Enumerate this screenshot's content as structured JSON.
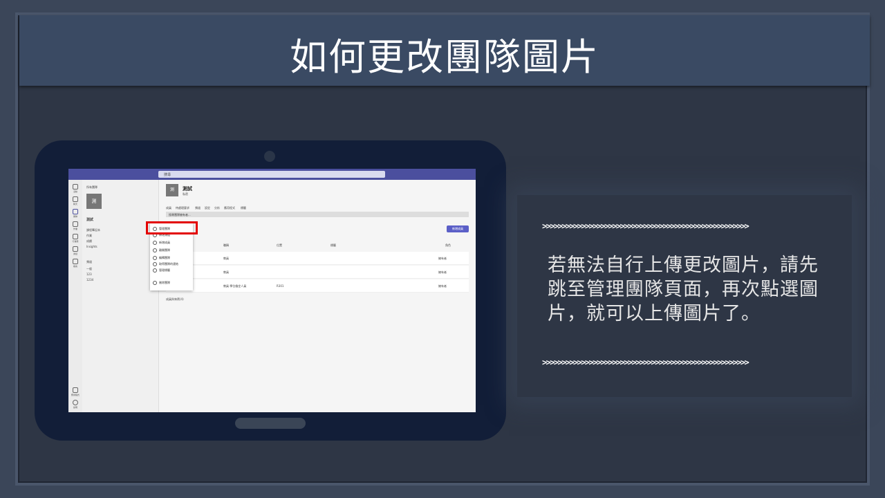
{
  "slide": {
    "title": "如何更改團隊圖片",
    "description": "若無法自行上傳更改圖片，請先跳至管理團隊頁面，再次點選圖片，就可以上傳圖片了。",
    "arrows_top": ">>>>>>>>>>>>>>>>>>>>>>>>>>>>>>>>>>>>>>>>>>>>>>>>>>>>>",
    "arrows_bottom": ">>>>>>>>>>>>>>>>>>>>>>>>>>>>>>>>>>>>>>>>>>>>>>>>>>>>>"
  },
  "screenshot": {
    "search_placeholder": "搜尋",
    "back_label": "所有團隊",
    "team_avatar_char": "測",
    "team_name": "測試",
    "team_subtitle": "私密",
    "left_items": [
      "課程筆記本",
      "作業",
      "成績",
      "Insights"
    ],
    "channels_header": "頻道",
    "channels": [
      "一般",
      "123",
      "1234"
    ],
    "tabs": [
      "成員",
      "待處理要求",
      "頻道",
      "設定",
      "分析",
      "應用程式",
      "標籤"
    ],
    "banner": "搜尋團隊擁有者...",
    "add_member": "新增成員",
    "columns": [
      "名稱",
      "職稱",
      "位置",
      "標籤",
      "角色"
    ],
    "rows": [
      {
        "title": "教員",
        "location": "",
        "role": "擁有者"
      },
      {
        "title": "教員",
        "location": "",
        "role": "擁有者"
      },
      {
        "title": "教員 學位檢定人員",
        "location": "R301",
        "role": "擁有者"
      }
    ],
    "members_footer": "成員與來賓(4)",
    "menu_items": [
      "管理團隊",
      "新增頻道",
      "新增成員",
      "離開團隊",
      "編輯團隊",
      "取得團隊的連結",
      "管理標籤",
      "刪除團隊"
    ],
    "rail_items": [
      "活動",
      "聊天",
      "團隊",
      "作業",
      "行事曆",
      "通話",
      "檔案",
      "應用程式",
      "說明"
    ]
  }
}
